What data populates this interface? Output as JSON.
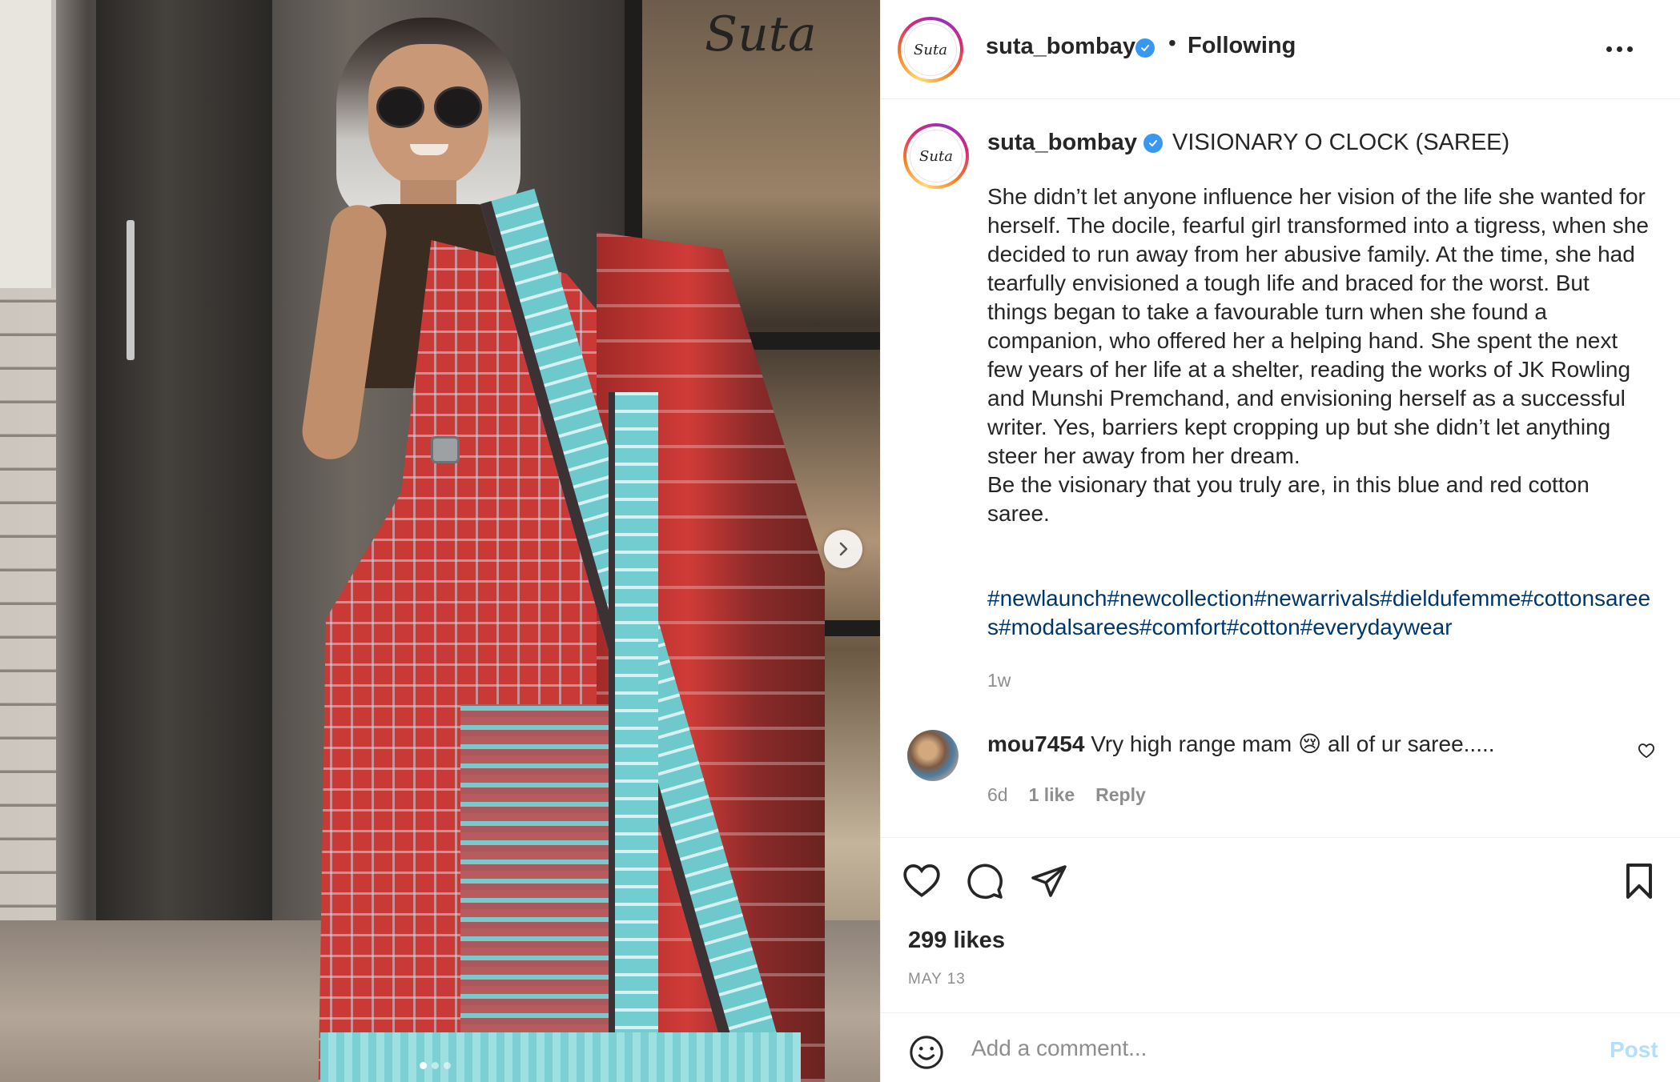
{
  "media": {
    "watermark": "Suta",
    "carousel_total": 3,
    "carousel_active": 1
  },
  "header": {
    "username": "suta_bombay",
    "separator": "•",
    "follow_state": "Following",
    "avatar_text": "Suta"
  },
  "caption": {
    "username": "suta_bombay",
    "title": "VISIONARY O CLOCK (SAREE)",
    "body": "She didn’t let anyone influence her vision of the life she wanted for herself. The docile, fearful girl transformed into a tigress, when she decided to run away from her abusive family. At the time, she had tearfully envisioned a tough life and braced for the worst. But things began to take a favourable turn when she found a companion, who offered her a helping hand. She spent the next few years of her life at a shelter, reading the works of JK Rowling and Munshi Premchand, and envisioning herself as a successful writer. Yes, barriers kept cropping up but she didn’t let anything steer her away from her dream.\nBe the visionary that you truly are, in this blue and red cotton saree.",
    "hashtags": "#newlaunch#newcollection#newarrivals#dieldufemme#cottonsarees#modalsarees#comfort#cotton#everydaywear",
    "age": "1w"
  },
  "comment": {
    "username": "mou7454",
    "text": "Vry high range mam 😢 all of ur saree.....",
    "time": "6d",
    "likes": "1 like",
    "reply": "Reply"
  },
  "actions": {
    "likes": "299 likes",
    "date": "MAY 13"
  },
  "add_comment": {
    "placeholder": "Add a comment...",
    "post_label": "Post"
  },
  "colors": {
    "verified": "#3897f0",
    "hashtag": "#00376b",
    "muted": "#8e8e8e",
    "post_disabled": "#b2dffc"
  },
  "icons": [
    "next-arrow-icon",
    "verified-badge-icon",
    "more-options-icon",
    "heart-icon",
    "comment-icon",
    "share-icon",
    "bookmark-icon",
    "emoji-icon",
    "comment-like-heart-icon"
  ]
}
